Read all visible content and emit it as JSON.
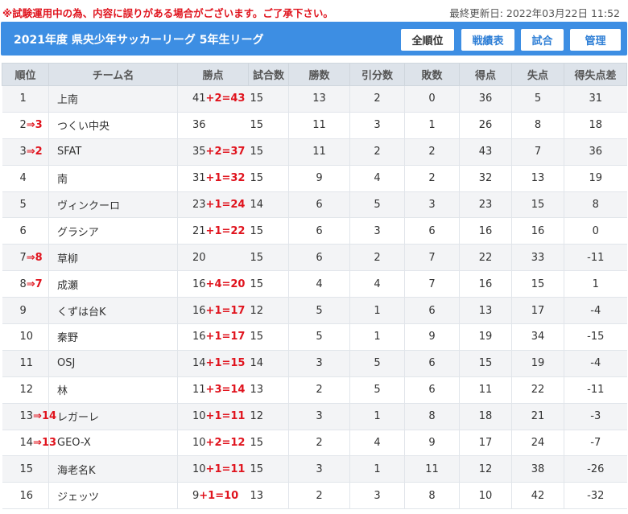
{
  "notice": "※試験運用中の為、内容に誤りがある場合がございます。ご了承下さい。",
  "updated": "最終更新日: 2022年03月22日 11:52",
  "header": {
    "title": "2021年度 県央少年サッカーリーグ 5年生リーグ",
    "buttons": [
      "全順位",
      "戦績表",
      "試合",
      "管理"
    ]
  },
  "table": {
    "headers": [
      "順位",
      "チーム名",
      "勝点",
      "試合数",
      "勝数",
      "引分数",
      "敗数",
      "得点",
      "失点",
      "得失点差"
    ],
    "rows": [
      {
        "rank": "1",
        "rank_change": "",
        "team": "上南",
        "points": "41",
        "bonus": "+2=43",
        "played": "15",
        "wins": "13",
        "draws": "2",
        "losses": "0",
        "gf": "36",
        "ga": "5",
        "gd": "31"
      },
      {
        "rank": "2",
        "rank_change": "⇒3",
        "team": "つくい中央",
        "points": "36",
        "bonus": "",
        "played": "15",
        "wins": "11",
        "draws": "3",
        "losses": "1",
        "gf": "26",
        "ga": "8",
        "gd": "18"
      },
      {
        "rank": "3",
        "rank_change": "⇒2",
        "team": "SFAT",
        "points": "35",
        "bonus": "+2=37",
        "played": "15",
        "wins": "11",
        "draws": "2",
        "losses": "2",
        "gf": "43",
        "ga": "7",
        "gd": "36"
      },
      {
        "rank": "4",
        "rank_change": "",
        "team": "南",
        "points": "31",
        "bonus": "+1=32",
        "played": "15",
        "wins": "9",
        "draws": "4",
        "losses": "2",
        "gf": "32",
        "ga": "13",
        "gd": "19"
      },
      {
        "rank": "5",
        "rank_change": "",
        "team": "ヴィンクーロ",
        "points": "23",
        "bonus": "+1=24",
        "played": "14",
        "wins": "6",
        "draws": "5",
        "losses": "3",
        "gf": "23",
        "ga": "15",
        "gd": "8"
      },
      {
        "rank": "6",
        "rank_change": "",
        "team": "グラシア",
        "points": "21",
        "bonus": "+1=22",
        "played": "15",
        "wins": "6",
        "draws": "3",
        "losses": "6",
        "gf": "16",
        "ga": "16",
        "gd": "0"
      },
      {
        "rank": "7",
        "rank_change": "⇒8",
        "team": "草柳",
        "points": "20",
        "bonus": "",
        "played": "15",
        "wins": "6",
        "draws": "2",
        "losses": "7",
        "gf": "22",
        "ga": "33",
        "gd": "-11"
      },
      {
        "rank": "8",
        "rank_change": "⇒7",
        "team": "成瀬",
        "points": "16",
        "bonus": "+4=20",
        "played": "15",
        "wins": "4",
        "draws": "4",
        "losses": "7",
        "gf": "16",
        "ga": "15",
        "gd": "1"
      },
      {
        "rank": "9",
        "rank_change": "",
        "team": "くずは台K",
        "points": "16",
        "bonus": "+1=17",
        "played": "12",
        "wins": "5",
        "draws": "1",
        "losses": "6",
        "gf": "13",
        "ga": "17",
        "gd": "-4"
      },
      {
        "rank": "10",
        "rank_change": "",
        "team": "秦野",
        "points": "16",
        "bonus": "+1=17",
        "played": "15",
        "wins": "5",
        "draws": "1",
        "losses": "9",
        "gf": "19",
        "ga": "34",
        "gd": "-15"
      },
      {
        "rank": "11",
        "rank_change": "",
        "team": "OSJ",
        "points": "14",
        "bonus": "+1=15",
        "played": "14",
        "wins": "3",
        "draws": "5",
        "losses": "6",
        "gf": "15",
        "ga": "19",
        "gd": "-4"
      },
      {
        "rank": "12",
        "rank_change": "",
        "team": "林",
        "points": "11",
        "bonus": "+3=14",
        "played": "13",
        "wins": "2",
        "draws": "5",
        "losses": "6",
        "gf": "11",
        "ga": "22",
        "gd": "-11"
      },
      {
        "rank": "13",
        "rank_change": "⇒14",
        "team": "レガーレ",
        "points": "10",
        "bonus": "+1=11",
        "played": "12",
        "wins": "3",
        "draws": "1",
        "losses": "8",
        "gf": "18",
        "ga": "21",
        "gd": "-3"
      },
      {
        "rank": "14",
        "rank_change": "⇒13",
        "team": "GEO-X",
        "points": "10",
        "bonus": "+2=12",
        "played": "15",
        "wins": "2",
        "draws": "4",
        "losses": "9",
        "gf": "17",
        "ga": "24",
        "gd": "-7"
      },
      {
        "rank": "15",
        "rank_change": "",
        "team": "海老名K",
        "points": "10",
        "bonus": "+1=11",
        "played": "15",
        "wins": "3",
        "draws": "1",
        "losses": "11",
        "gf": "12",
        "ga": "38",
        "gd": "-26"
      },
      {
        "rank": "16",
        "rank_change": "",
        "team": "ジェッツ",
        "points": "9",
        "bonus": "+1=10",
        "played": "13",
        "wins": "2",
        "draws": "3",
        "losses": "8",
        "gf": "10",
        "ga": "42",
        "gd": "-32"
      }
    ]
  }
}
